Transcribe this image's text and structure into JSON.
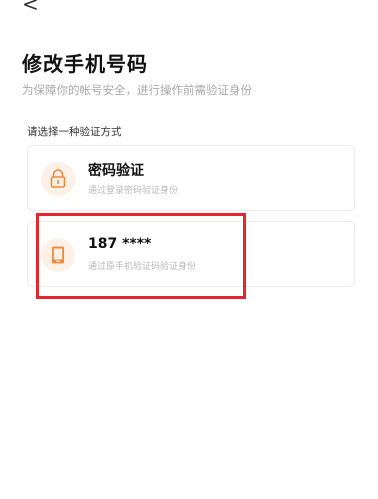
{
  "header": {
    "back_label": "<",
    "title": "修改手机号码",
    "subtitle": "为保障你的帐号安全，进行操作前需验证身份"
  },
  "section": {
    "label": "请选择一种验证方式"
  },
  "options": [
    {
      "title": "密码验证",
      "description": "通过登录密码验证身份",
      "icon": "lock-icon"
    },
    {
      "title": "187 ****",
      "description": "通过原手机验证码验证身份",
      "icon": "phone-icon"
    }
  ],
  "colors": {
    "accent": "#f08a3c",
    "icon_background": "#fdf0e6",
    "highlight": "#e0282e",
    "muted_text": "#a9a9a9"
  }
}
